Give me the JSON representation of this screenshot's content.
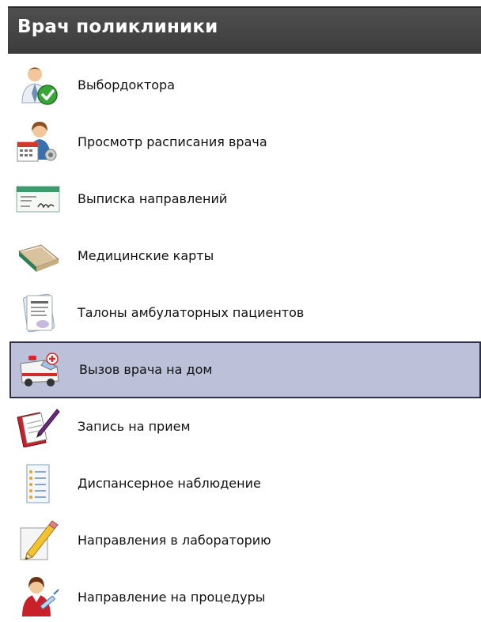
{
  "panel": {
    "title": "Врач поликлиники"
  },
  "colors": {
    "header_bg": "#444444",
    "header_text": "#ffffff",
    "selected_bg": "#bcc0d8",
    "selected_border": "#2f2f45"
  },
  "menu": {
    "selected_index": 5,
    "items": [
      {
        "label": "Выбордоктора",
        "icon": "doctor-checkmark-icon"
      },
      {
        "label": "Просмотр расписания врача",
        "icon": "doctor-calendar-icon"
      },
      {
        "label": "Выписка направлений",
        "icon": "referral-document-icon"
      },
      {
        "label": "Медицинские карты",
        "icon": "medical-cards-icon"
      },
      {
        "label": "Талоны амбулаторных пациентов",
        "icon": "outpatient-coupon-icon"
      },
      {
        "label": "Вызов врача на дом",
        "icon": "ambulance-icon"
      },
      {
        "label": "Запись на прием",
        "icon": "appointment-book-icon"
      },
      {
        "label": "Диспансерное наблюдение",
        "icon": "checklist-icon"
      },
      {
        "label": "Направления в лабораторию",
        "icon": "pencil-note-icon"
      },
      {
        "label": "Направление на процедуры",
        "icon": "nurse-procedure-icon"
      }
    ]
  }
}
